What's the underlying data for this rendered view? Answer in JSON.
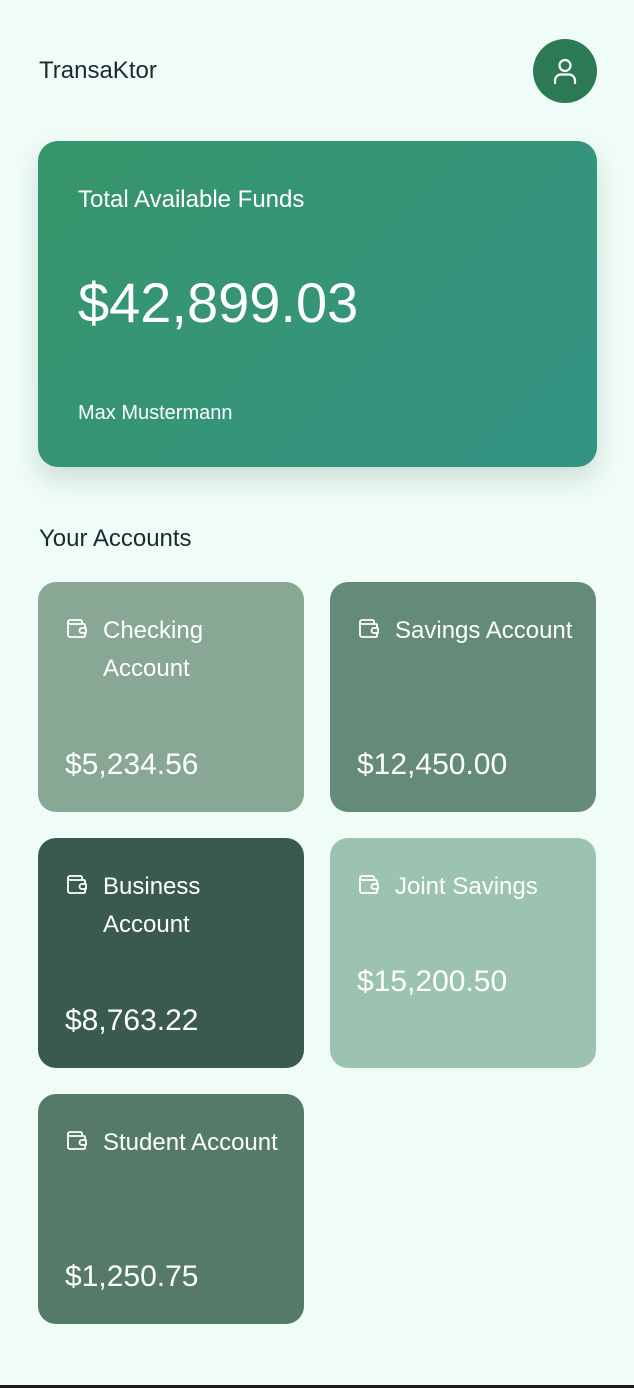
{
  "app": {
    "title": "TransaKtor"
  },
  "profile": {
    "icon": "user-icon",
    "background": "#2c7a55"
  },
  "funds": {
    "label": "Total Available Funds",
    "amount": "$42,899.03",
    "owner": "Max Mustermann",
    "gradient_start": "#37956a",
    "gradient_end": "#349485"
  },
  "accounts": {
    "section_title": "Your Accounts",
    "items": [
      {
        "name": "Checking Account",
        "balance": "$5,234.56",
        "color": "#88a895",
        "icon": "wallet-icon"
      },
      {
        "name": "Savings Account",
        "balance": "$12,450.00",
        "color": "#648a78",
        "icon": "wallet-icon"
      },
      {
        "name": "Business Account",
        "balance": "$8,763.22",
        "color": "#3a5a4f",
        "icon": "wallet-icon"
      },
      {
        "name": "Joint Savings",
        "balance": "$15,200.50",
        "color": "#9cc3b0",
        "icon": "wallet-icon"
      },
      {
        "name": "Student Account",
        "balance": "$1,250.75",
        "color": "#557a68",
        "icon": "wallet-icon"
      }
    ]
  }
}
